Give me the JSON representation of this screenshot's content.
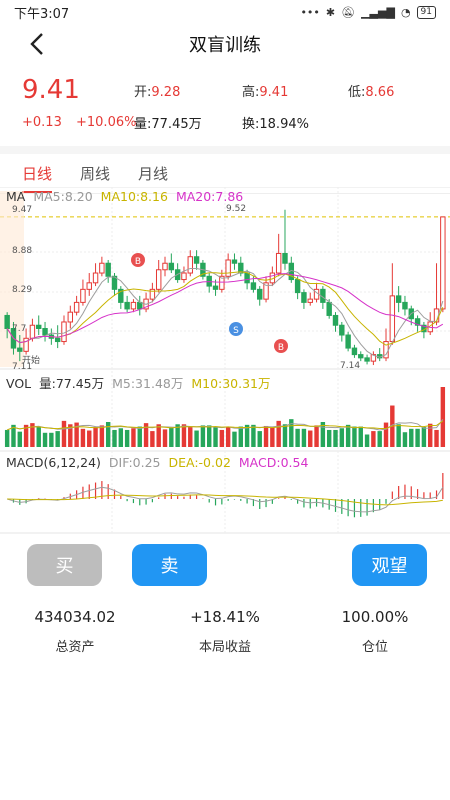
{
  "status": {
    "time": "下午3:07",
    "battery": "91"
  },
  "nav": {
    "title": "双盲训练"
  },
  "quote": {
    "price": "9.41",
    "open_label": "开:",
    "open": "9.28",
    "high_label": "高:",
    "high": "9.41",
    "low_label": "低:",
    "low": "8.66",
    "change": "+0.13",
    "change_pct": "+10.06%",
    "volume_label": "量:",
    "volume": "77.45万",
    "turnover_label": "换:",
    "turnover": "18.94%"
  },
  "tabs": [
    {
      "label": "日线"
    },
    {
      "label": "周线"
    },
    {
      "label": "月线"
    }
  ],
  "legend": {
    "ma": "MA",
    "ma5": "MA5:8.20",
    "ma10": "MA10:8.16",
    "ma20": "MA20:7.86",
    "vol": "VOL",
    "vol_val": "量:77.45万",
    "m5": "M5:31.48万",
    "m10": "M10:30.31万",
    "macd": "MACD(6,12,24)",
    "dif": "DIF:0.25",
    "dea": "DEA:-0.02",
    "macd_val": "MACD:0.54"
  },
  "chart_labels": {
    "y_top": "9.47",
    "y_mid1": "8.88",
    "y_mid2": "8.29",
    "y_mid3": "7.7",
    "y_bottom": "7.11",
    "high_mark": "9.52",
    "low_mark": "7.14",
    "start": "开始",
    "buy_marker": "B",
    "sell_marker": "S"
  },
  "colors": {
    "up": "#e53935",
    "down": "#26a65b",
    "ma5": "#9e9e9e",
    "ma10": "#c8b400",
    "ma20": "#d633c9",
    "accent": "#2196f3"
  },
  "actions": {
    "buy": "买",
    "sell": "卖",
    "wait": "观望"
  },
  "stats": [
    {
      "value": "434034.02",
      "label": "总资产"
    },
    {
      "value": "+18.41%",
      "label": "本局收益"
    },
    {
      "value": "100.00%",
      "label": "仓位"
    }
  ],
  "chart_data": {
    "type": "candlestick",
    "ylim": [
      7.11,
      9.47
    ],
    "candles": [
      [
        7.9,
        7.7,
        7.95,
        7.55
      ],
      [
        7.7,
        7.4,
        7.8,
        7.3
      ],
      [
        7.4,
        7.35,
        7.6,
        7.2
      ],
      [
        7.35,
        7.55,
        7.7,
        7.3
      ],
      [
        7.55,
        7.75,
        7.85,
        7.5
      ],
      [
        7.75,
        7.7,
        7.9,
        7.6
      ],
      [
        7.7,
        7.6,
        7.8,
        7.5
      ],
      [
        7.6,
        7.55,
        7.7,
        7.45
      ],
      [
        7.55,
        7.5,
        7.75,
        7.4
      ],
      [
        7.5,
        7.8,
        7.9,
        7.45
      ],
      [
        7.8,
        7.95,
        8.05,
        7.7
      ],
      [
        7.95,
        8.1,
        8.2,
        7.9
      ],
      [
        8.1,
        8.3,
        8.45,
        8.05
      ],
      [
        8.3,
        8.4,
        8.55,
        8.2
      ],
      [
        8.4,
        8.55,
        8.7,
        8.35
      ],
      [
        8.55,
        8.7,
        8.8,
        8.5
      ],
      [
        8.7,
        8.5,
        8.75,
        8.4
      ],
      [
        8.5,
        8.3,
        8.55,
        8.2
      ],
      [
        8.3,
        8.1,
        8.35,
        8.0
      ],
      [
        8.1,
        8.0,
        8.2,
        7.95
      ],
      [
        8.0,
        8.1,
        8.15,
        7.95
      ],
      [
        8.1,
        8.0,
        8.2,
        7.9
      ],
      [
        8.0,
        8.15,
        8.25,
        7.95
      ],
      [
        8.15,
        8.3,
        8.4,
        8.1
      ],
      [
        8.3,
        8.6,
        8.75,
        8.25
      ],
      [
        8.6,
        8.7,
        8.8,
        8.5
      ],
      [
        8.7,
        8.6,
        8.85,
        8.55
      ],
      [
        8.6,
        8.45,
        8.7,
        8.4
      ],
      [
        8.45,
        8.55,
        8.65,
        8.4
      ],
      [
        8.55,
        8.8,
        8.9,
        8.5
      ],
      [
        8.8,
        8.7,
        8.9,
        8.6
      ],
      [
        8.7,
        8.5,
        8.75,
        8.45
      ],
      [
        8.5,
        8.35,
        8.55,
        8.25
      ],
      [
        8.35,
        8.3,
        8.45,
        8.2
      ],
      [
        8.3,
        8.5,
        8.6,
        8.25
      ],
      [
        8.5,
        8.75,
        8.85,
        8.45
      ],
      [
        8.75,
        8.7,
        8.85,
        8.6
      ],
      [
        8.7,
        8.55,
        8.8,
        8.5
      ],
      [
        8.55,
        8.4,
        8.6,
        8.3
      ],
      [
        8.4,
        8.3,
        8.5,
        8.25
      ],
      [
        8.3,
        8.15,
        8.35,
        8.05
      ],
      [
        8.15,
        8.4,
        8.5,
        8.1
      ],
      [
        8.4,
        8.55,
        8.65,
        8.35
      ],
      [
        8.55,
        8.85,
        9.15,
        8.5
      ],
      [
        8.85,
        8.7,
        9.52,
        8.6
      ],
      [
        8.7,
        8.45,
        8.8,
        8.4
      ],
      [
        8.45,
        8.25,
        8.5,
        8.15
      ],
      [
        8.25,
        8.1,
        8.3,
        8.0
      ],
      [
        8.1,
        8.15,
        8.25,
        8.05
      ],
      [
        8.15,
        8.3,
        8.4,
        8.1
      ],
      [
        8.3,
        8.1,
        8.35,
        8.0
      ],
      [
        8.1,
        7.9,
        8.15,
        7.85
      ],
      [
        7.9,
        7.75,
        7.95,
        7.65
      ],
      [
        7.75,
        7.6,
        7.8,
        7.5
      ],
      [
        7.6,
        7.4,
        7.65,
        7.35
      ],
      [
        7.4,
        7.3,
        7.45,
        7.25
      ],
      [
        7.3,
        7.25,
        7.35,
        7.2
      ],
      [
        7.25,
        7.2,
        7.3,
        7.15
      ],
      [
        7.2,
        7.3,
        7.35,
        7.14
      ],
      [
        7.3,
        7.25,
        7.4,
        7.2
      ],
      [
        7.25,
        7.5,
        7.7,
        7.2
      ],
      [
        7.5,
        8.2,
        8.7,
        7.45
      ],
      [
        8.2,
        8.1,
        8.35,
        7.95
      ],
      [
        8.1,
        8.0,
        8.2,
        7.9
      ],
      [
        8.0,
        7.85,
        8.05,
        7.75
      ],
      [
        7.85,
        7.75,
        7.9,
        7.65
      ],
      [
        7.75,
        7.65,
        7.8,
        7.55
      ],
      [
        7.65,
        7.8,
        7.95,
        7.6
      ],
      [
        7.8,
        8.0,
        8.7,
        7.75
      ],
      [
        8.0,
        9.41,
        9.41,
        7.95
      ]
    ]
  }
}
